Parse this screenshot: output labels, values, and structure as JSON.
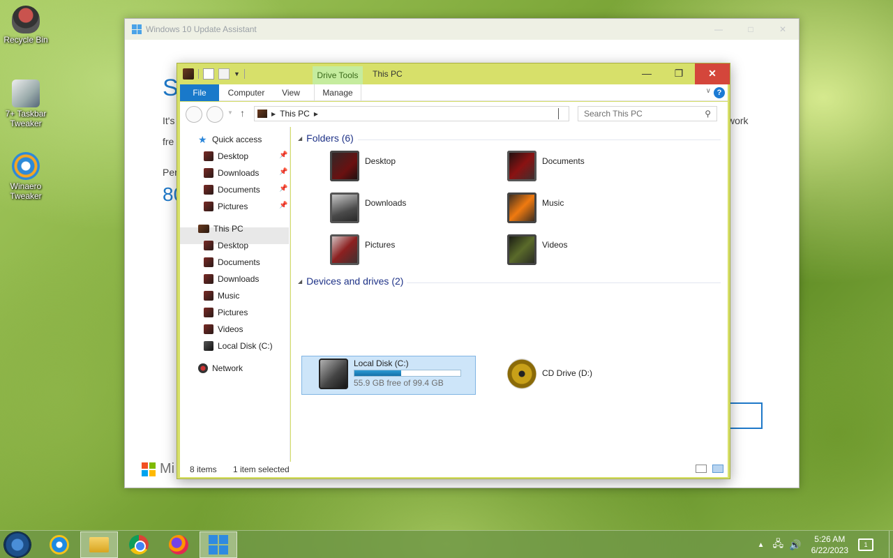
{
  "desktop": {
    "icons": [
      {
        "label": "Recycle Bin",
        "icon": "recycle-bin-icon"
      },
      {
        "label": "7+ Taskbar Tweaker",
        "icon": "taskbar-tweaker-icon"
      },
      {
        "label": "Winaero Tweaker",
        "icon": "winaero-tweaker-icon"
      }
    ]
  },
  "background_window": {
    "title": "Windows 10 Update Assistant",
    "fragments": {
      "heading": "S",
      "line1": "It's",
      "line1_end": "work",
      "line2": "fre",
      "line3": "Per",
      "percent": "80",
      "brand": "Mi"
    }
  },
  "explorer": {
    "title": "This PC",
    "contextual_tab": "Drive Tools",
    "ribbon_tabs": {
      "file": "File",
      "computer": "Computer",
      "view": "View",
      "manage": "Manage"
    },
    "address": "This PC",
    "search_placeholder": "Search This PC",
    "nav": {
      "quick_access": "Quick access",
      "quick_items": [
        "Desktop",
        "Downloads",
        "Documents",
        "Pictures"
      ],
      "this_pc": "This PC",
      "pc_items": [
        "Desktop",
        "Documents",
        "Downloads",
        "Music",
        "Pictures",
        "Videos",
        "Local Disk (C:)"
      ],
      "network": "Network"
    },
    "folders_header": "Folders (6)",
    "folders": [
      "Desktop",
      "Documents",
      "Downloads",
      "Music",
      "Pictures",
      "Videos"
    ],
    "drives_header": "Devices and drives (2)",
    "drives": {
      "c_name": "Local Disk (C:)",
      "c_free": "55.9 GB free of 99.4 GB",
      "c_used_fraction": 0.438,
      "d_name": "CD Drive (D:)"
    },
    "status": {
      "items": "8 items",
      "selected": "1 item selected"
    }
  },
  "taskbar": {
    "apps": [
      "internet-explorer-icon",
      "file-explorer-icon",
      "chrome-icon",
      "firefox-icon",
      "windows-update-icon"
    ],
    "time": "5:26 AM",
    "date": "6/22/2023",
    "notifications": "1"
  },
  "colors": {
    "accent": "#1979ca",
    "explorer_frame": "#d7e06a",
    "selection": "#cde5f9"
  }
}
